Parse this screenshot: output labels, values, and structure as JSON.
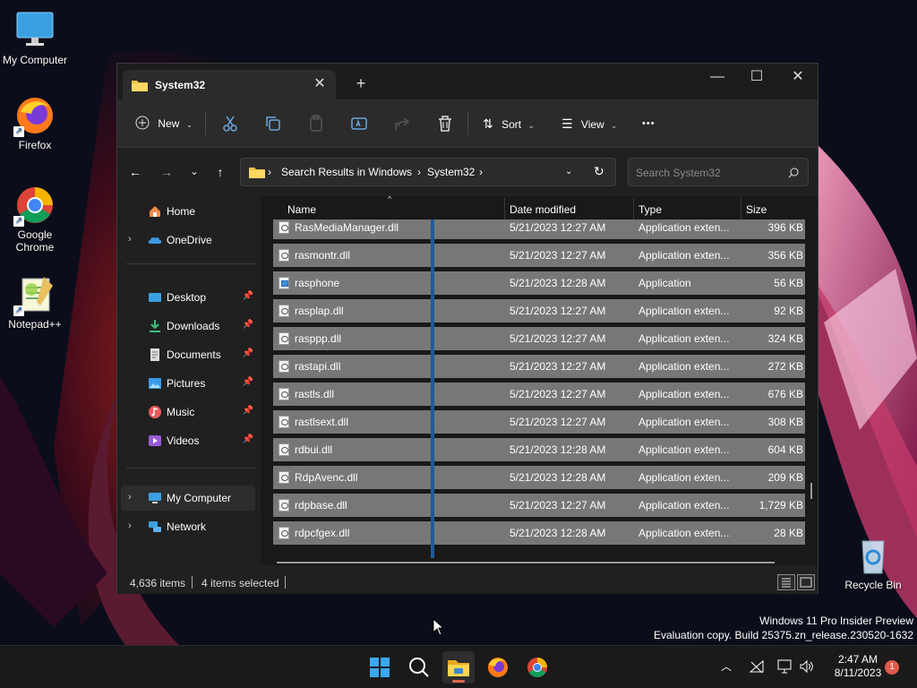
{
  "desktop": {
    "icons": [
      {
        "label": "My Computer",
        "icon": "monitor-icon"
      },
      {
        "label": "Firefox",
        "icon": "firefox-icon"
      },
      {
        "label": "Google Chrome",
        "icon": "chrome-icon"
      },
      {
        "label": "Notepad++",
        "icon": "notepadpp-icon"
      },
      {
        "label": "Recycle Bin",
        "icon": "recycle-bin-icon"
      }
    ],
    "watermark": {
      "line1": "Windows 11 Pro Insider Preview",
      "line2": "Evaluation copy. Build 25375.zn_release.230520-1632"
    }
  },
  "window": {
    "tab_title": "System32",
    "new_tab_glyph": "+",
    "close_tab_glyph": "✕",
    "controls": {
      "minimize": "—",
      "maximize": "☐",
      "close": "✕"
    }
  },
  "toolbar": {
    "new_label": "New",
    "sort_label": "Sort",
    "view_label": "View",
    "more_glyph": "•••"
  },
  "navigation": {
    "address": [
      "Search Results in Windows",
      "System32"
    ],
    "search_placeholder": "Search System32"
  },
  "sidebar": {
    "items": [
      {
        "label": "Home",
        "icon": "home-icon"
      },
      {
        "label": "OneDrive",
        "icon": "onedrive-icon"
      },
      {
        "label": "Desktop",
        "icon": "desktop-folder-icon"
      },
      {
        "label": "Downloads",
        "icon": "downloads-icon"
      },
      {
        "label": "Documents",
        "icon": "documents-icon"
      },
      {
        "label": "Pictures",
        "icon": "pictures-icon"
      },
      {
        "label": "Music",
        "icon": "music-icon"
      },
      {
        "label": "Videos",
        "icon": "videos-icon"
      },
      {
        "label": "My Computer",
        "icon": "monitor-icon"
      },
      {
        "label": "Network",
        "icon": "network-icon"
      }
    ]
  },
  "columns": {
    "name": "Name",
    "date": "Date modified",
    "type": "Type",
    "size": "Size"
  },
  "files": [
    {
      "name": "RasMediaManager.dll",
      "date": "5/21/2023 12:27 AM",
      "type": "Application exten...",
      "size": "396 KB"
    },
    {
      "name": "rasmontr.dll",
      "date": "5/21/2023 12:27 AM",
      "type": "Application exten...",
      "size": "356 KB"
    },
    {
      "name": "rasphone",
      "date": "5/21/2023 12:28 AM",
      "type": "Application",
      "size": "56 KB"
    },
    {
      "name": "rasplap.dll",
      "date": "5/21/2023 12:27 AM",
      "type": "Application exten...",
      "size": "92 KB"
    },
    {
      "name": "rasppp.dll",
      "date": "5/21/2023 12:27 AM",
      "type": "Application exten...",
      "size": "324 KB"
    },
    {
      "name": "rastapi.dll",
      "date": "5/21/2023 12:27 AM",
      "type": "Application exten...",
      "size": "272 KB"
    },
    {
      "name": "rastls.dll",
      "date": "5/21/2023 12:27 AM",
      "type": "Application exten...",
      "size": "676 KB"
    },
    {
      "name": "rastlsext.dll",
      "date": "5/21/2023 12:27 AM",
      "type": "Application exten...",
      "size": "308 KB"
    },
    {
      "name": "rdbui.dll",
      "date": "5/21/2023 12:28 AM",
      "type": "Application exten...",
      "size": "604 KB"
    },
    {
      "name": "RdpAvenc.dll",
      "date": "5/21/2023 12:28 AM",
      "type": "Application exten...",
      "size": "209 KB"
    },
    {
      "name": "rdpbase.dll",
      "date": "5/21/2023 12:27 AM",
      "type": "Application exten...",
      "size": "1,729 KB"
    },
    {
      "name": "rdpcfgex.dll",
      "date": "5/21/2023 12:28 AM",
      "type": "Application exten...",
      "size": "28 KB"
    }
  ],
  "status": {
    "item_count": "4,636 items",
    "selected": "4 items selected"
  },
  "taskbar": {
    "clock_time": "2:47 AM",
    "clock_date": "8/11/2023",
    "notification_count": "1"
  }
}
